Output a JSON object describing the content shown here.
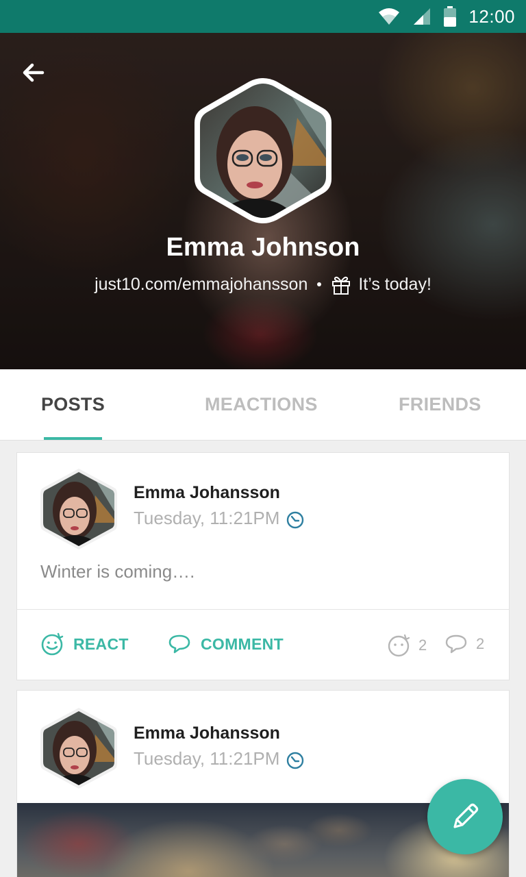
{
  "status_bar": {
    "time": "12:00"
  },
  "profile": {
    "name": "Emma Johnson",
    "link": "just10.com/emmajohansson",
    "birthday": "It’s today!"
  },
  "tabs": [
    {
      "label": "POSTS",
      "active": true
    },
    {
      "label": "MEACTIONS",
      "active": false
    },
    {
      "label": "FRIENDS",
      "active": false
    }
  ],
  "posts": [
    {
      "author": "Emma Johansson",
      "time": "Tuesday, 11:21PM",
      "text": "Winter is coming….",
      "actions": {
        "react_label": "REACT",
        "comment_label": "COMMENT"
      },
      "stats": {
        "reactions": "2",
        "comments": "2"
      }
    },
    {
      "author": "Emma Johansson",
      "time": "Tuesday, 11:21PM"
    }
  ],
  "colors": {
    "accent": "#3bb8a5",
    "status_bar": "#0f7a6b"
  },
  "icons": {
    "back": "arrow-left-icon",
    "gift": "gift-icon",
    "clock": "clock-icon",
    "react": "smiley-icon",
    "comment": "speech-bubble-icon",
    "fab": "pencil-icon"
  }
}
